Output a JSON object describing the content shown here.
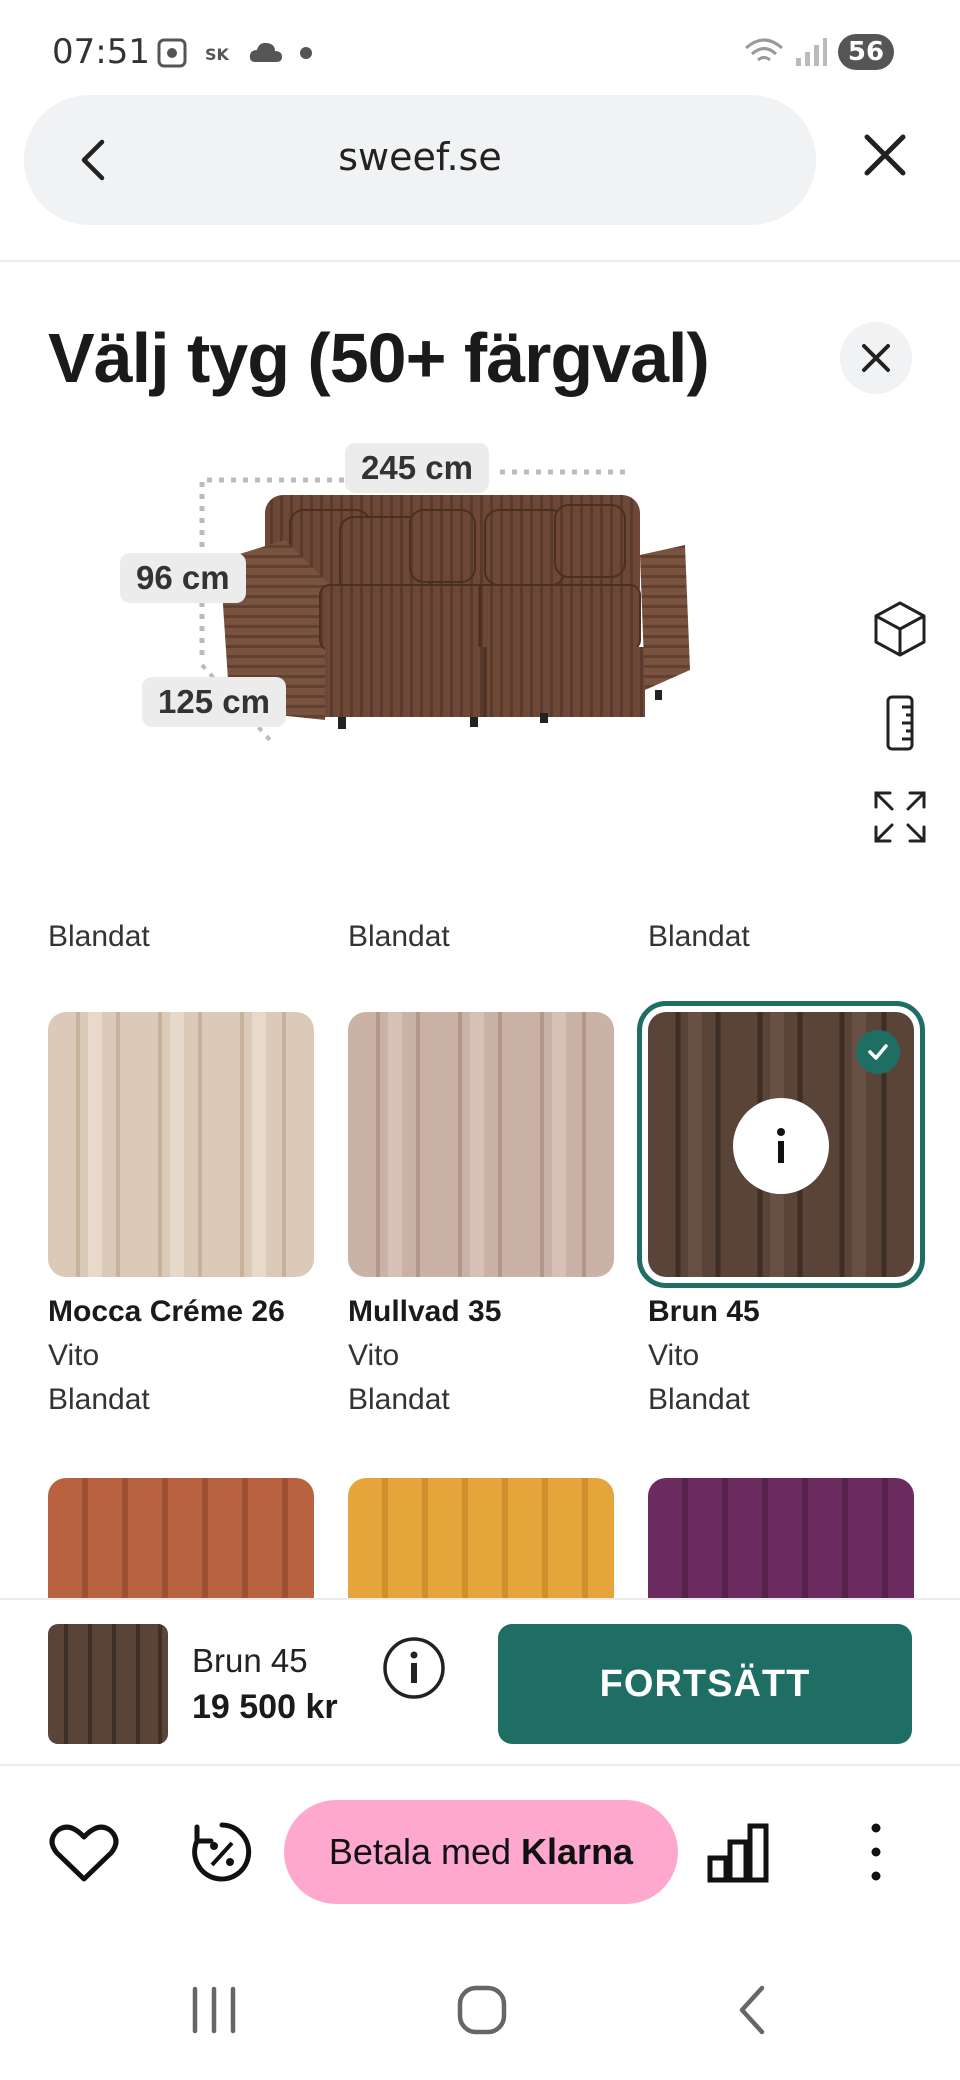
{
  "status_bar": {
    "time": "07:51",
    "battery": "56"
  },
  "browser": {
    "url": "sweef.se"
  },
  "panel": {
    "title": "Välj tyg (50+ färgval)"
  },
  "product": {
    "dimensions": {
      "width": "245 cm",
      "height": "96 cm",
      "depth": "125 cm"
    }
  },
  "grid": {
    "top_labels": [
      "Blandat",
      "Blandat",
      "Blandat"
    ],
    "items": [
      {
        "name": "Mocca Créme 26",
        "brand": "Vito",
        "type": "Blandat",
        "color": "#dccab8",
        "selected": false
      },
      {
        "name": "Mullvad 35",
        "brand": "Vito",
        "type": "Blandat",
        "color": "#cbb2a6",
        "selected": false
      },
      {
        "name": "Brun 45",
        "brand": "Vito",
        "type": "Blandat",
        "color": "#5a4438",
        "selected": true
      }
    ],
    "next_row_colors": [
      "#b8623f",
      "#e6a53a",
      "#6b2b5f"
    ]
  },
  "selection": {
    "name": "Brun 45",
    "price": "19 500 kr",
    "continue_label": "FORTSÄTT"
  },
  "toolbar": {
    "klarna_prefix": "Betala med",
    "klarna_brand": "Klarna"
  },
  "colors": {
    "accent": "#1f6e64",
    "klarna_pink": "#ffa8cd"
  }
}
